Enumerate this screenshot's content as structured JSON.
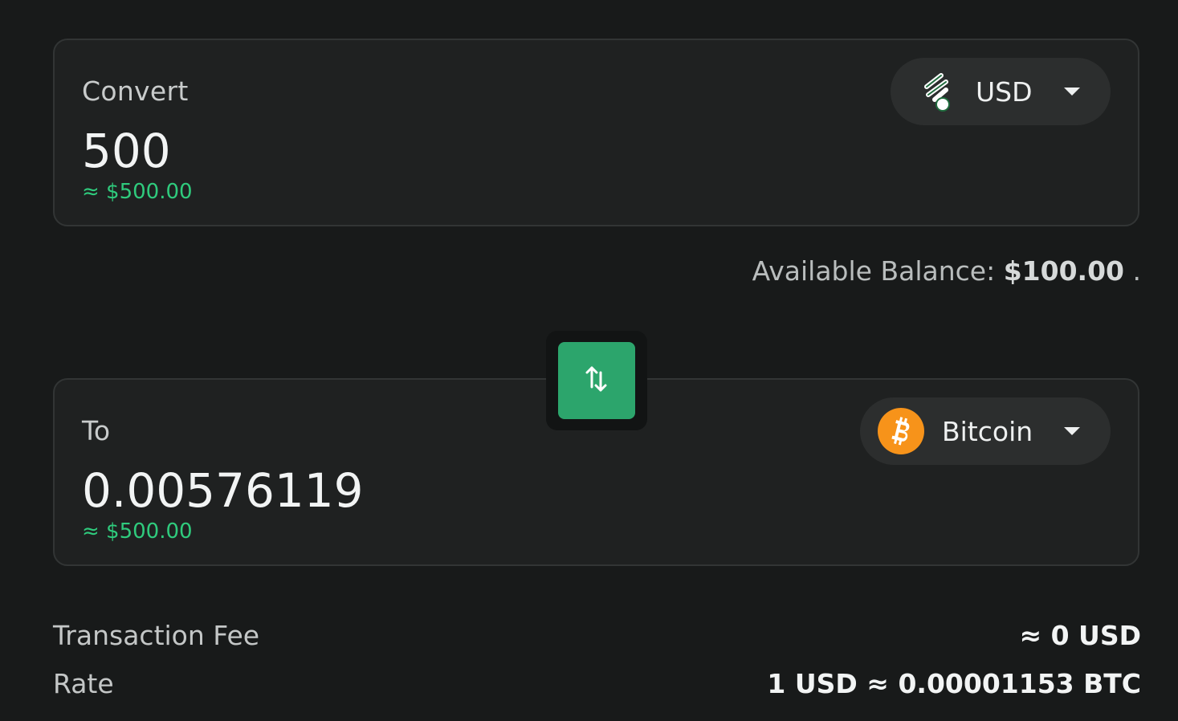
{
  "from": {
    "label": "Convert",
    "amount": "500",
    "fiat_equiv": "≈ $500.00",
    "token": {
      "name": "USD",
      "icon": "usd-leaf-icon"
    }
  },
  "balance": {
    "label": "Available Balance:",
    "value": "$100.00",
    "suffix": "."
  },
  "swap": {
    "icon": "swap-arrows-icon",
    "color": "#2ca56c"
  },
  "to": {
    "label": "To",
    "amount": "0.00576119",
    "fiat_equiv": "≈ $500.00",
    "token": {
      "name": "Bitcoin",
      "icon": "bitcoin-icon",
      "color": "#f7931a"
    }
  },
  "details": {
    "fee_label": "Transaction Fee",
    "fee_value": "≈ 0 USD",
    "rate_label": "Rate",
    "rate_value": "1 USD ≈ 0.00001153 BTC"
  },
  "colors": {
    "background": "#181a1a",
    "panel": "#1f2121",
    "accent_green": "#2fcb7d",
    "bitcoin_orange": "#f7931a"
  }
}
